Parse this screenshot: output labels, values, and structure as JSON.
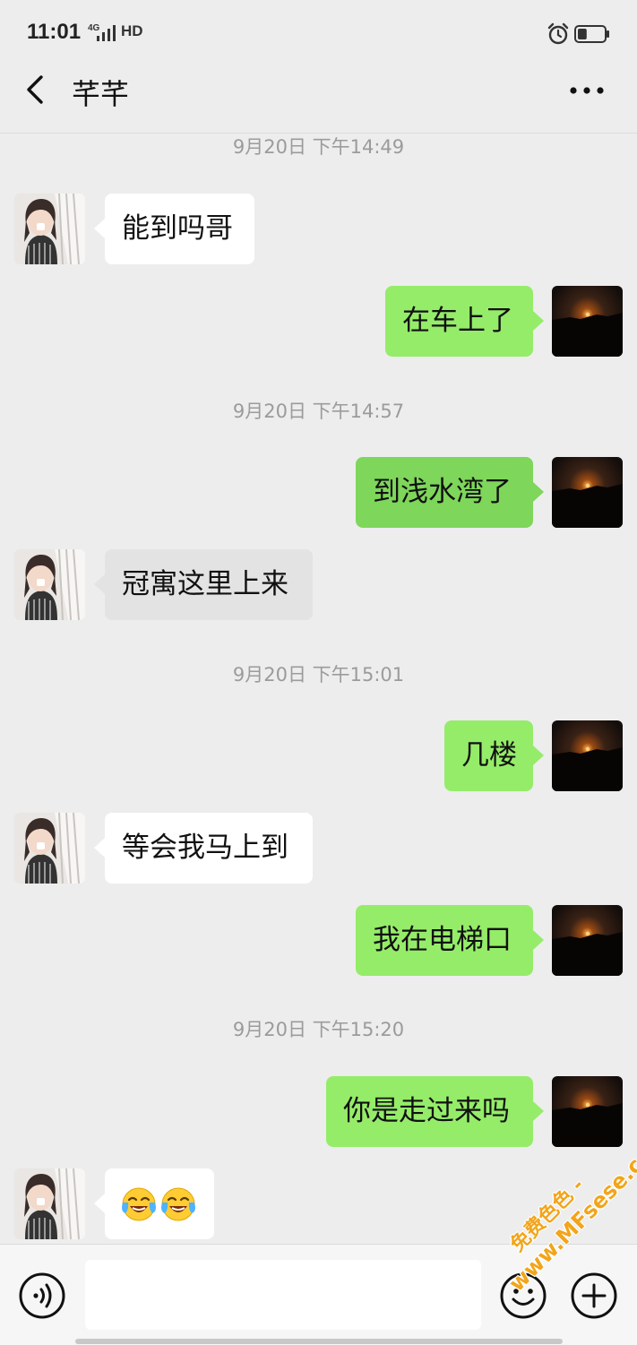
{
  "status_bar": {
    "time": "11:01",
    "network": "4G",
    "hd_label": "HD",
    "battery_level": 0.35
  },
  "nav": {
    "title": "芊芊"
  },
  "messages": [
    {
      "type": "time",
      "text": "9月20日 下午14:49"
    },
    {
      "type": "in",
      "text": "能到吗哥"
    },
    {
      "type": "out",
      "text": "在车上了"
    },
    {
      "type": "time",
      "text": "9月20日 下午14:57"
    },
    {
      "type": "out",
      "text": "到浅水湾了"
    },
    {
      "type": "in",
      "text": "冠寓这里上来"
    },
    {
      "type": "time",
      "text": "9月20日 下午15:01"
    },
    {
      "type": "out",
      "text": "几楼"
    },
    {
      "type": "in",
      "text": "等会我马上到"
    },
    {
      "type": "out",
      "text": "我在电梯口"
    },
    {
      "type": "time",
      "text": "9月20日 下午15:20"
    },
    {
      "type": "out",
      "text": "你是走过来吗"
    },
    {
      "type": "in",
      "text": "",
      "emoji": [
        "face-tears-of-joy-icon",
        "face-tears-of-joy-icon"
      ]
    }
  ],
  "input": {
    "value": "",
    "placeholder": ""
  },
  "watermark": {
    "line1": "免费色色 -",
    "line2": "www.MFsese.com"
  },
  "colors": {
    "background": "#ededed",
    "bubble_out": "#95ec69",
    "bubble_in": "#ffffff",
    "timestamp": "#9b9b9b"
  }
}
